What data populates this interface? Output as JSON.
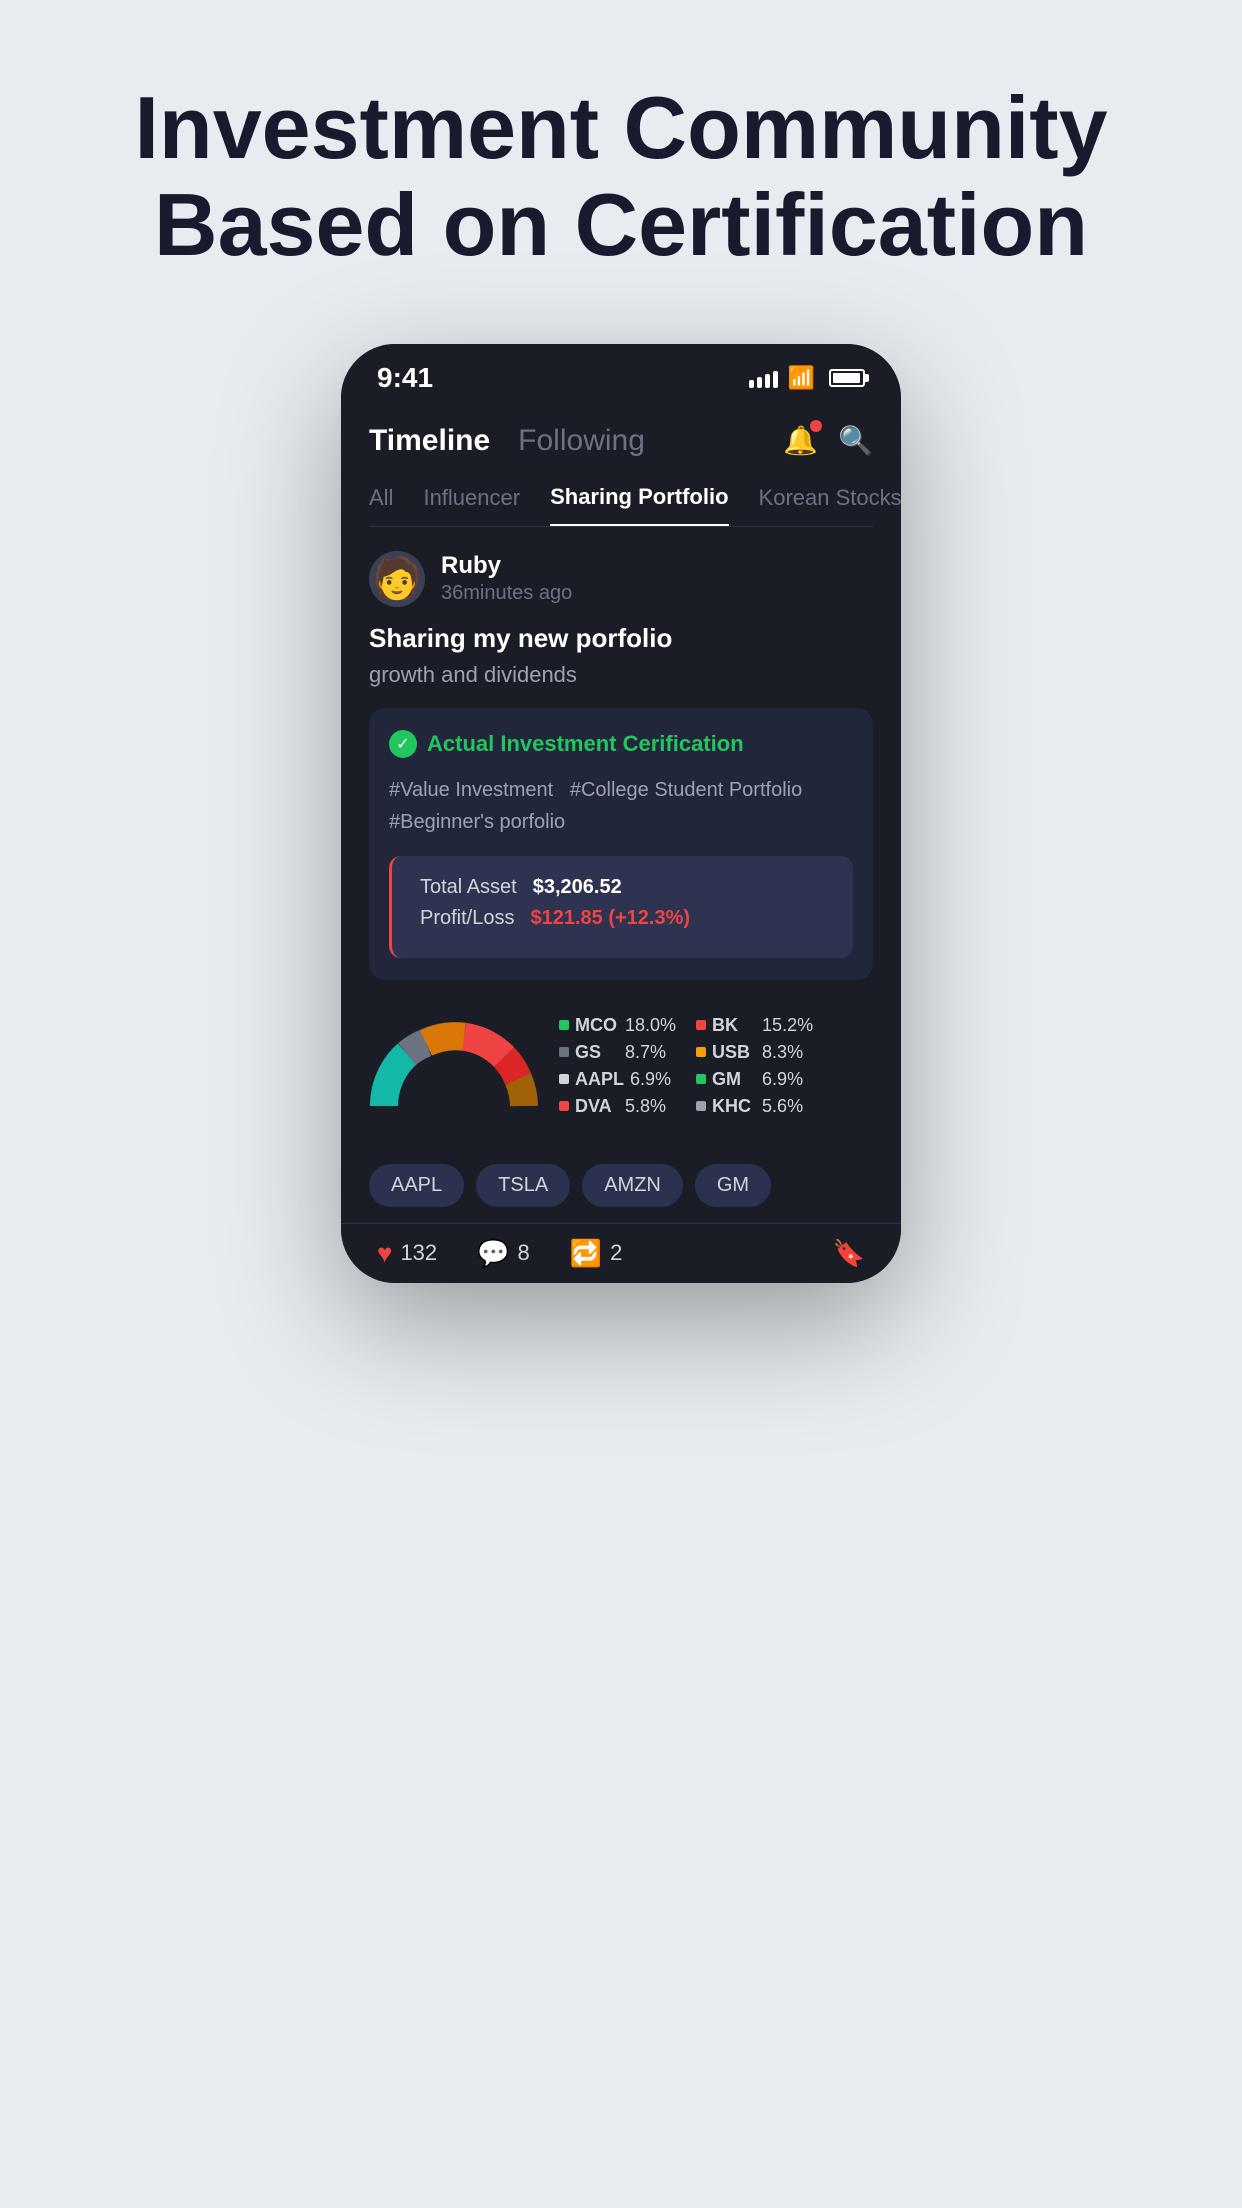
{
  "headline": {
    "line1": "Investment Community",
    "line2": "Based on Certification"
  },
  "status_bar": {
    "time": "9:41"
  },
  "header": {
    "tab_active": "Timeline",
    "tab_inactive": "Following"
  },
  "filter_tabs": {
    "items": [
      "All",
      "Influencer",
      "Sharing Portfolio",
      "Korean Stocks"
    ],
    "active_index": 2
  },
  "post": {
    "author": "Ruby",
    "time_ago": "36minutes ago",
    "title": "Sharing my new porfolio",
    "subtitle": "growth and dividends",
    "cert_label": "Actual Investment Cerification",
    "tags": "#Value Investment  #College Student Portfolio\n#Beginner's porfolio",
    "total_asset_label": "Total Asset",
    "total_asset_value": "$3,206.52",
    "profit_loss_label": "Profit/Loss",
    "profit_loss_value": "$121.85 (+12.3%)"
  },
  "legend": [
    {
      "ticker": "MCO",
      "pct": "18.0%",
      "color": "#22c55e"
    },
    {
      "ticker": "BK",
      "pct": "15.2%",
      "color": "#ef4444"
    },
    {
      "ticker": "GS",
      "pct": "8.7%",
      "color": "#6b7280"
    },
    {
      "ticker": "USB",
      "pct": "8.3%",
      "color": "#f59e0b"
    },
    {
      "ticker": "AAPL",
      "pct": "6.9%",
      "color": "#d1d5db"
    },
    {
      "ticker": "GM",
      "pct": "6.9%",
      "color": "#22c55e"
    },
    {
      "ticker": "DVA",
      "pct": "5.8%",
      "color": "#ef4444"
    },
    {
      "ticker": "KHC",
      "pct": "5.6%",
      "color": "#9ca3af"
    }
  ],
  "stock_tags": [
    "AAPL",
    "TSLA",
    "AMZN",
    "GM"
  ],
  "actions": {
    "likes": "132",
    "comments": "8",
    "shares": "2"
  }
}
